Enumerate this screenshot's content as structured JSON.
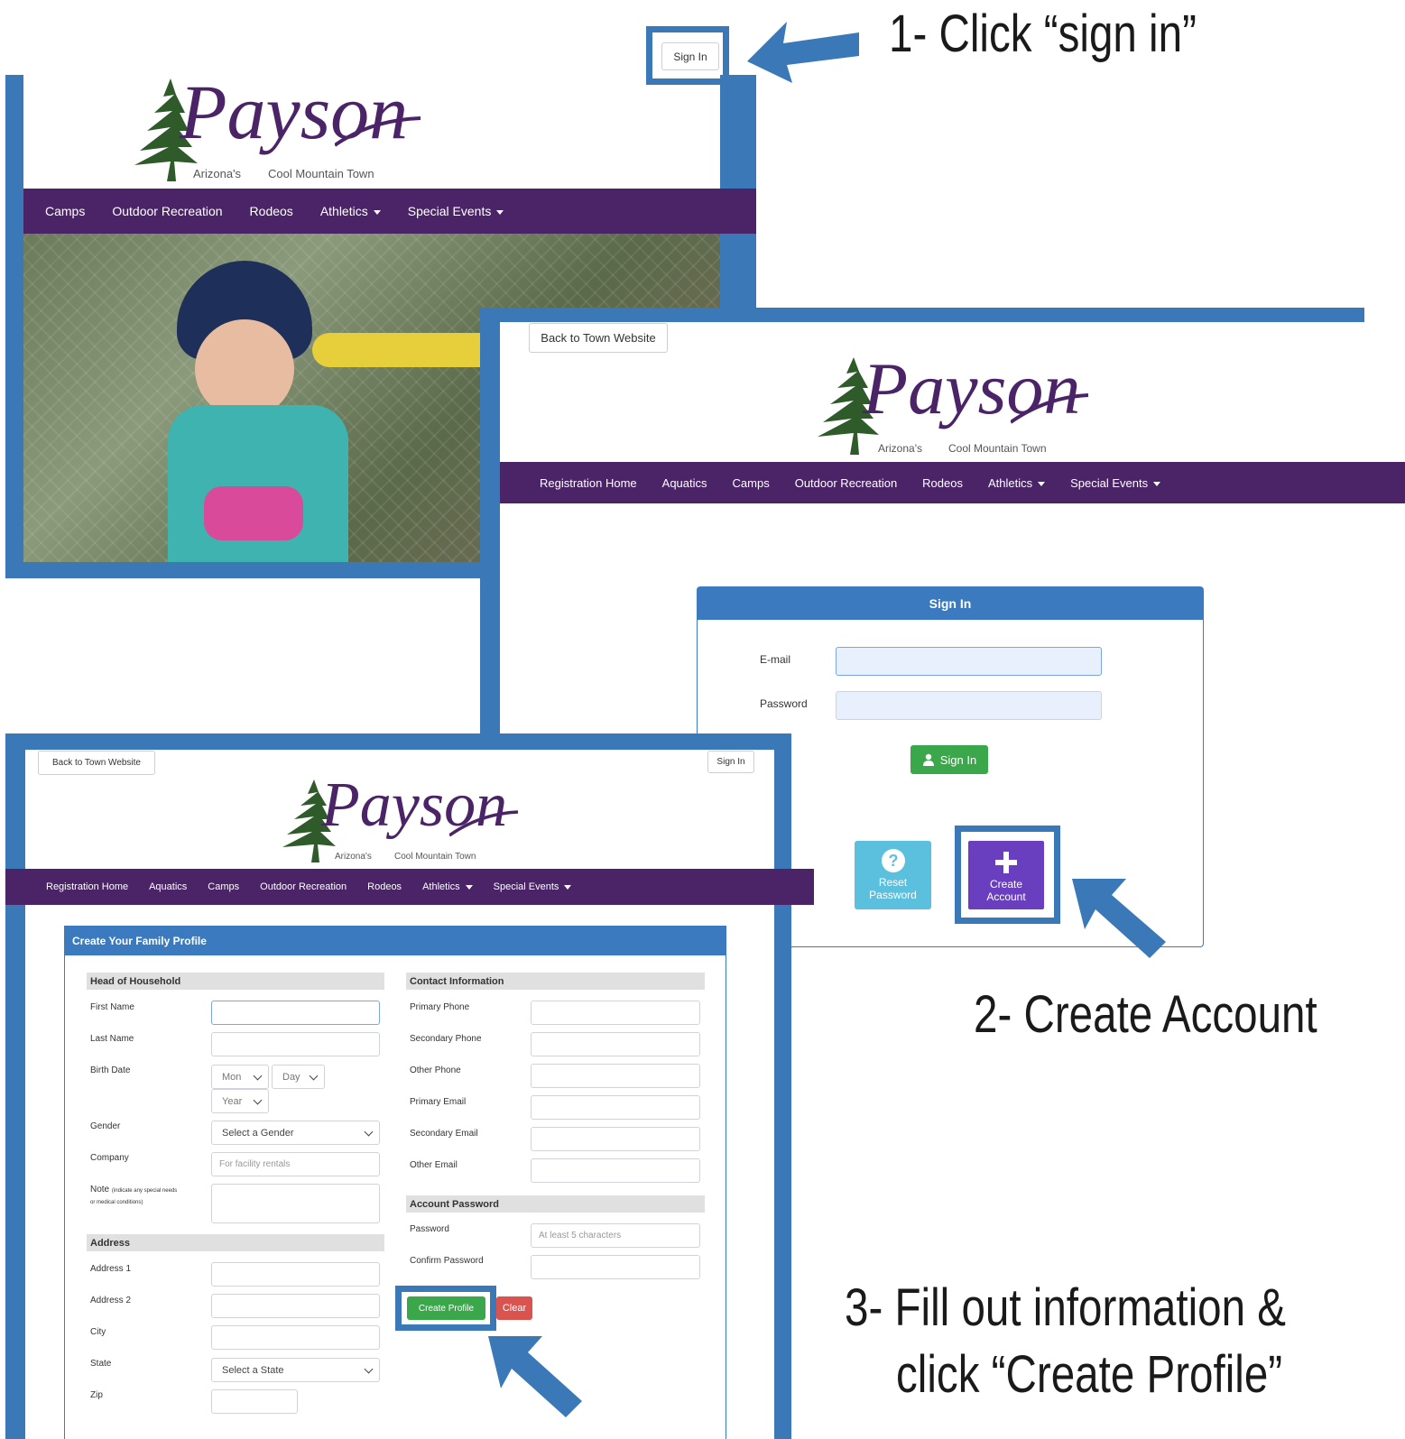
{
  "instructions": {
    "step1": "1- Click “sign in”",
    "step2": "2- Create Account",
    "step3_line1": "3- Fill out information &",
    "step3_line2": "click “Create Profile”"
  },
  "logo": {
    "name": "Payson",
    "tagline_left": "Arizona's",
    "tagline_right": "Cool Mountain Town"
  },
  "home_page": {
    "sign_in_button": "Sign In",
    "nav": [
      "Camps",
      "Outdoor Recreation",
      "Rodeos",
      "Athletics",
      "Special Events"
    ]
  },
  "signin_page": {
    "back_button": "Back to Town Website",
    "nav": [
      "Registration Home",
      "Aquatics",
      "Camps",
      "Outdoor Recreation",
      "Rodeos",
      "Athletics",
      "Special Events"
    ],
    "panel_title": "Sign In",
    "email_label": "E-mail",
    "password_label": "Password",
    "sign_in_button": "Sign In",
    "reset_line1": "Reset",
    "reset_line2": "Password",
    "create_line1": "Create",
    "create_line2": "Account"
  },
  "profile_page": {
    "back_button": "Back to Town Website",
    "sign_in_button": "Sign In",
    "nav": [
      "Registration Home",
      "Aquatics",
      "Camps",
      "Outdoor Recreation",
      "Rodeos",
      "Athletics",
      "Special Events"
    ],
    "panel_title": "Create Your Family Profile",
    "head_section": "Head of Household",
    "first_name": "First Name",
    "last_name": "Last Name",
    "birth_date": "Birth Date",
    "mon": "Mon",
    "day": "Day",
    "year": "Year",
    "gender": "Gender",
    "gender_select": "Select a Gender",
    "company": "Company",
    "company_placeholder": "For facility rentals",
    "note": "Note",
    "note_hint1": "(indicate any special needs",
    "note_hint2": "or medical conditions)",
    "address_section": "Address",
    "address1": "Address 1",
    "address2": "Address 2",
    "city": "City",
    "state": "State",
    "state_select": "Select a State",
    "zip": "Zip",
    "contact_section": "Contact Information",
    "primary_phone": "Primary Phone",
    "secondary_phone": "Secondary Phone",
    "other_phone": "Other Phone",
    "primary_email": "Primary Email",
    "secondary_email": "Secondary Email",
    "other_email": "Other Email",
    "account_section": "Account Password",
    "password": "Password",
    "password_placeholder": "At least 5 characters",
    "confirm_password": "Confirm Password",
    "create_profile": "Create Profile",
    "clear": "Clear"
  },
  "colors": {
    "accent_blue": "#3a78b8",
    "nav_purple": "#4a2466",
    "panel_blue": "#3b7abf",
    "green": "#3aa84a",
    "teal": "#5bc0de",
    "purple_button": "#6a3fbf",
    "red": "#d9534f"
  }
}
